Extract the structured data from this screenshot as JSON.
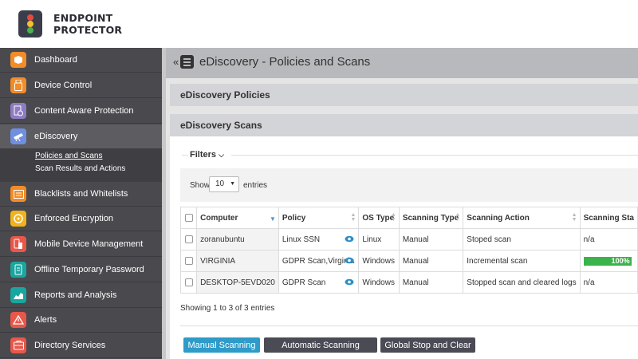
{
  "brand": {
    "line1": "ENDPOINT",
    "line2": "PROTECTOR",
    "logo_colors": [
      "#e54b3c",
      "#f2c12e",
      "#4cb050"
    ]
  },
  "sidebar": {
    "items": [
      {
        "label": "Dashboard",
        "icon": "dashboard-icon",
        "color": "#f28c28"
      },
      {
        "label": "Device Control",
        "icon": "usb-icon",
        "color": "#f28c28"
      },
      {
        "label": "Content Aware Protection",
        "icon": "document-shield-icon",
        "color": "#8e7cc3"
      },
      {
        "label": "eDiscovery",
        "icon": "telescope-icon",
        "color": "#6f8fe0"
      },
      {
        "label": "Blacklists and Whitelists",
        "icon": "list-icon",
        "color": "#f28c28"
      },
      {
        "label": "Enforced Encryption",
        "icon": "lock-icon",
        "color": "#f2b21e"
      },
      {
        "label": "Mobile Device Management",
        "icon": "mobile-icon",
        "color": "#e8574a"
      },
      {
        "label": "Offline Temporary Password",
        "icon": "clock-icon",
        "color": "#1aa6a0"
      },
      {
        "label": "Reports and Analysis",
        "icon": "chart-icon",
        "color": "#1aa6a0"
      },
      {
        "label": "Alerts",
        "icon": "warning-icon",
        "color": "#e8574a"
      },
      {
        "label": "Directory Services",
        "icon": "sitemap-icon",
        "color": "#e8574a"
      }
    ],
    "subitems": [
      {
        "label": "Policies and Scans"
      },
      {
        "label": "Scan Results and Actions"
      }
    ]
  },
  "main": {
    "title": "eDiscovery - Policies and Scans",
    "policies_panel": "eDiscovery Policies",
    "scans_panel": "eDiscovery Scans",
    "filters_label": "Filters",
    "show_label": "Show",
    "entries_value": "10",
    "entries_label": "entries",
    "showing_text": "Showing 1 to 3 of 3 entries"
  },
  "table": {
    "columns": [
      "Computer",
      "Policy",
      "OS Type",
      "Scanning Type",
      "Scanning Action",
      "Scanning Sta"
    ],
    "rows": [
      {
        "computer": "zoranubuntu",
        "policy": "Linux SSN",
        "os": "Linux",
        "type": "Manual",
        "action": "Stoped scan",
        "status": "n/a"
      },
      {
        "computer": "VIRGINIA",
        "policy": "GDPR Scan,Virginia",
        "os": "Windows",
        "type": "Manual",
        "action": "Incremental scan",
        "status": "100%",
        "progress": 100
      },
      {
        "computer": "DESKTOP-5EVD020",
        "policy": "GDPR Scan",
        "os": "Windows",
        "type": "Manual",
        "action": "Stopped scan and cleared logs",
        "status": "n/a"
      }
    ]
  },
  "buttons": {
    "manual": "Manual Scanning",
    "automatic": "Automatic Scanning",
    "global_stop": "Global Stop and Clear"
  }
}
